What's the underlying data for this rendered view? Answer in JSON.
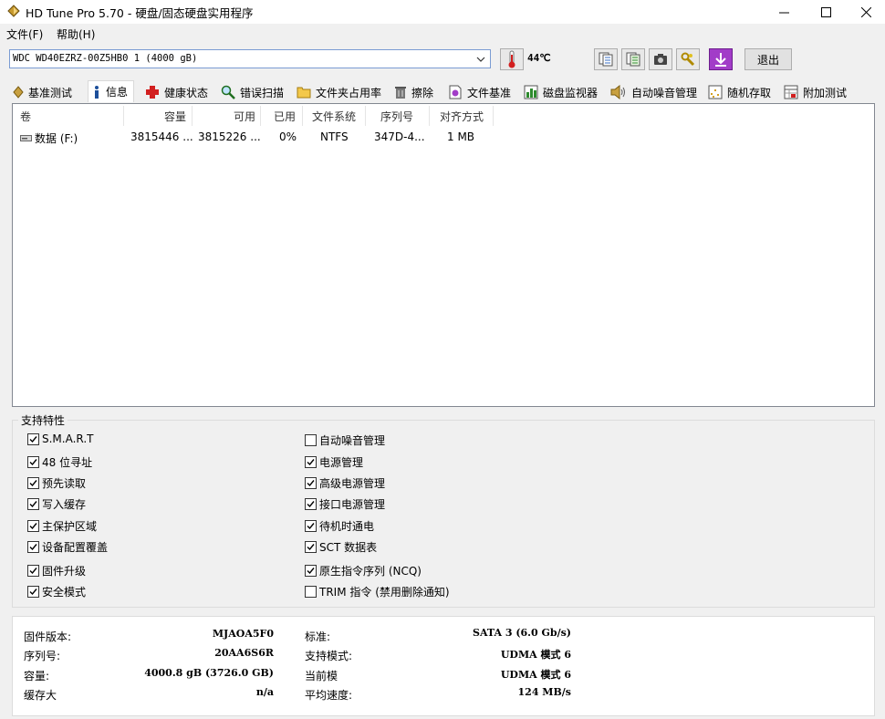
{
  "window": {
    "title": "HD Tune Pro 5.70 - 硬盘/固态硬盘实用程序"
  },
  "menu": {
    "file": "文件(F)",
    "help": "帮助(H)"
  },
  "toolbar": {
    "drive": "WDC WD40EZRZ-00Z5HB0  1 (4000 gB)",
    "temperature": "44℃",
    "exit_label": "退出"
  },
  "tabs": [
    "基准测试",
    "信息",
    "健康状态",
    "错误扫描",
    "文件夹占用率",
    "擦除",
    "文件基准",
    "磁盘监视器",
    "自动噪音管理",
    "随机存取",
    "附加测试"
  ],
  "volumes": {
    "headers": [
      "卷",
      "容量",
      "可用",
      "已用",
      "文件系统",
      "序列号",
      "对齐方式"
    ],
    "rows": [
      {
        "volume": "数据 (F:)",
        "capacity": "3815446 ...",
        "available": "3815226 ...",
        "used": "0%",
        "fs": "NTFS",
        "serial": "347D-4...",
        "align": "1 MB"
      }
    ]
  },
  "features": {
    "title": "支持特性",
    "left": [
      {
        "label": "S.M.A.R.T",
        "checked": true
      },
      {
        "label": "48 位寻址",
        "checked": true
      },
      {
        "label": "预先读取",
        "checked": true
      },
      {
        "label": "写入缓存",
        "checked": true
      },
      {
        "label": "主保护区域",
        "checked": true
      },
      {
        "label": "设备配置覆盖",
        "checked": true
      },
      {
        "label": "固件升级",
        "checked": true
      },
      {
        "label": "安全模式",
        "checked": true
      }
    ],
    "right": [
      {
        "label": "自动噪音管理",
        "checked": false
      },
      {
        "label": "电源管理",
        "checked": true
      },
      {
        "label": "高级电源管理",
        "checked": true
      },
      {
        "label": "接口电源管理",
        "checked": true
      },
      {
        "label": "待机时通电",
        "checked": true
      },
      {
        "label": "SCT 数据表",
        "checked": true
      },
      {
        "label": "原生指令序列 (NCQ)",
        "checked": true
      },
      {
        "label": "TRIM 指令 (禁用删除通知)",
        "checked": false
      }
    ]
  },
  "info": {
    "firmware_label": "固件版本:",
    "firmware": "MJAOA5F0",
    "serial_label": "序列号:",
    "serial": "20AA6S6R",
    "capacity_label": "容量:",
    "capacity": "4000.8 gB (3726.0 GB)",
    "cache_label": "缓存大",
    "cache": "n/a",
    "standard_label": "标准:",
    "standard": "SATA 3 (6.0 Gb/s)",
    "supported_label": "支持模式:",
    "supported": "UDMA 模式 6",
    "current_label": "当前模",
    "current": "UDMA 模式 6",
    "speed_label": "平均速度:",
    "speed": "124 MB/s"
  }
}
